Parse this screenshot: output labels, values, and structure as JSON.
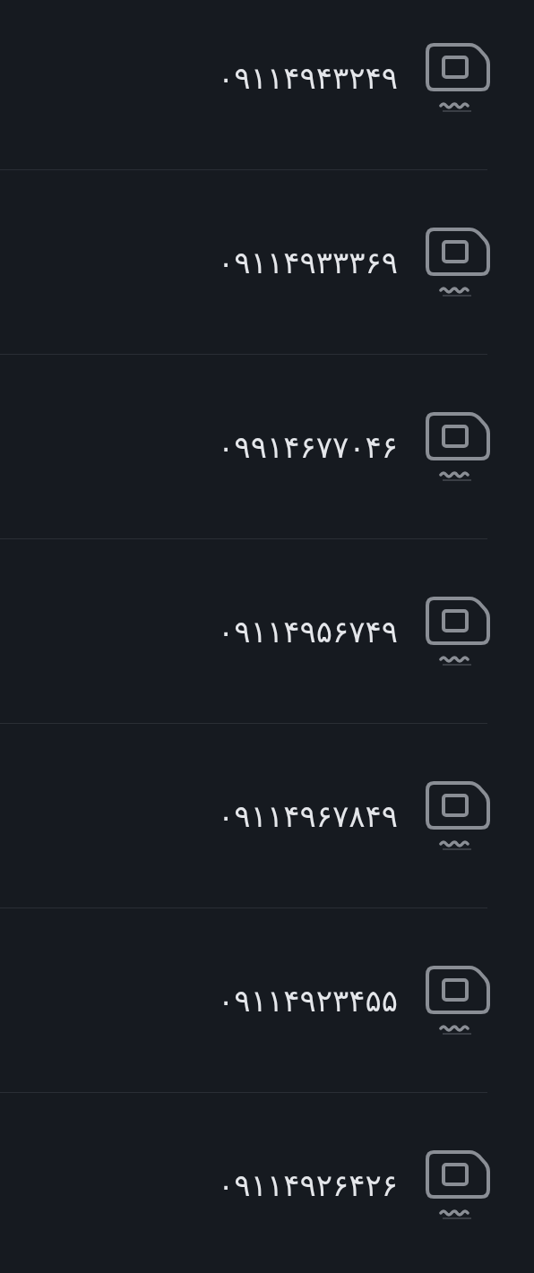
{
  "contacts": [
    {
      "phone": "۰۹۱۱۴۹۴۳۲۴۹"
    },
    {
      "phone": "۰۹۱۱۴۹۳۳۳۶۹"
    },
    {
      "phone": "۰۹۹۱۴۶۷۷۰۴۶"
    },
    {
      "phone": "۰۹۱۱۴۹۵۶۷۴۹"
    },
    {
      "phone": "۰۹۱۱۴۹۶۷۸۴۹"
    },
    {
      "phone": "۰۹۱۱۴۹۲۳۴۵۵"
    },
    {
      "phone": "۰۹۱۱۴۹۲۶۴۲۶"
    }
  ]
}
